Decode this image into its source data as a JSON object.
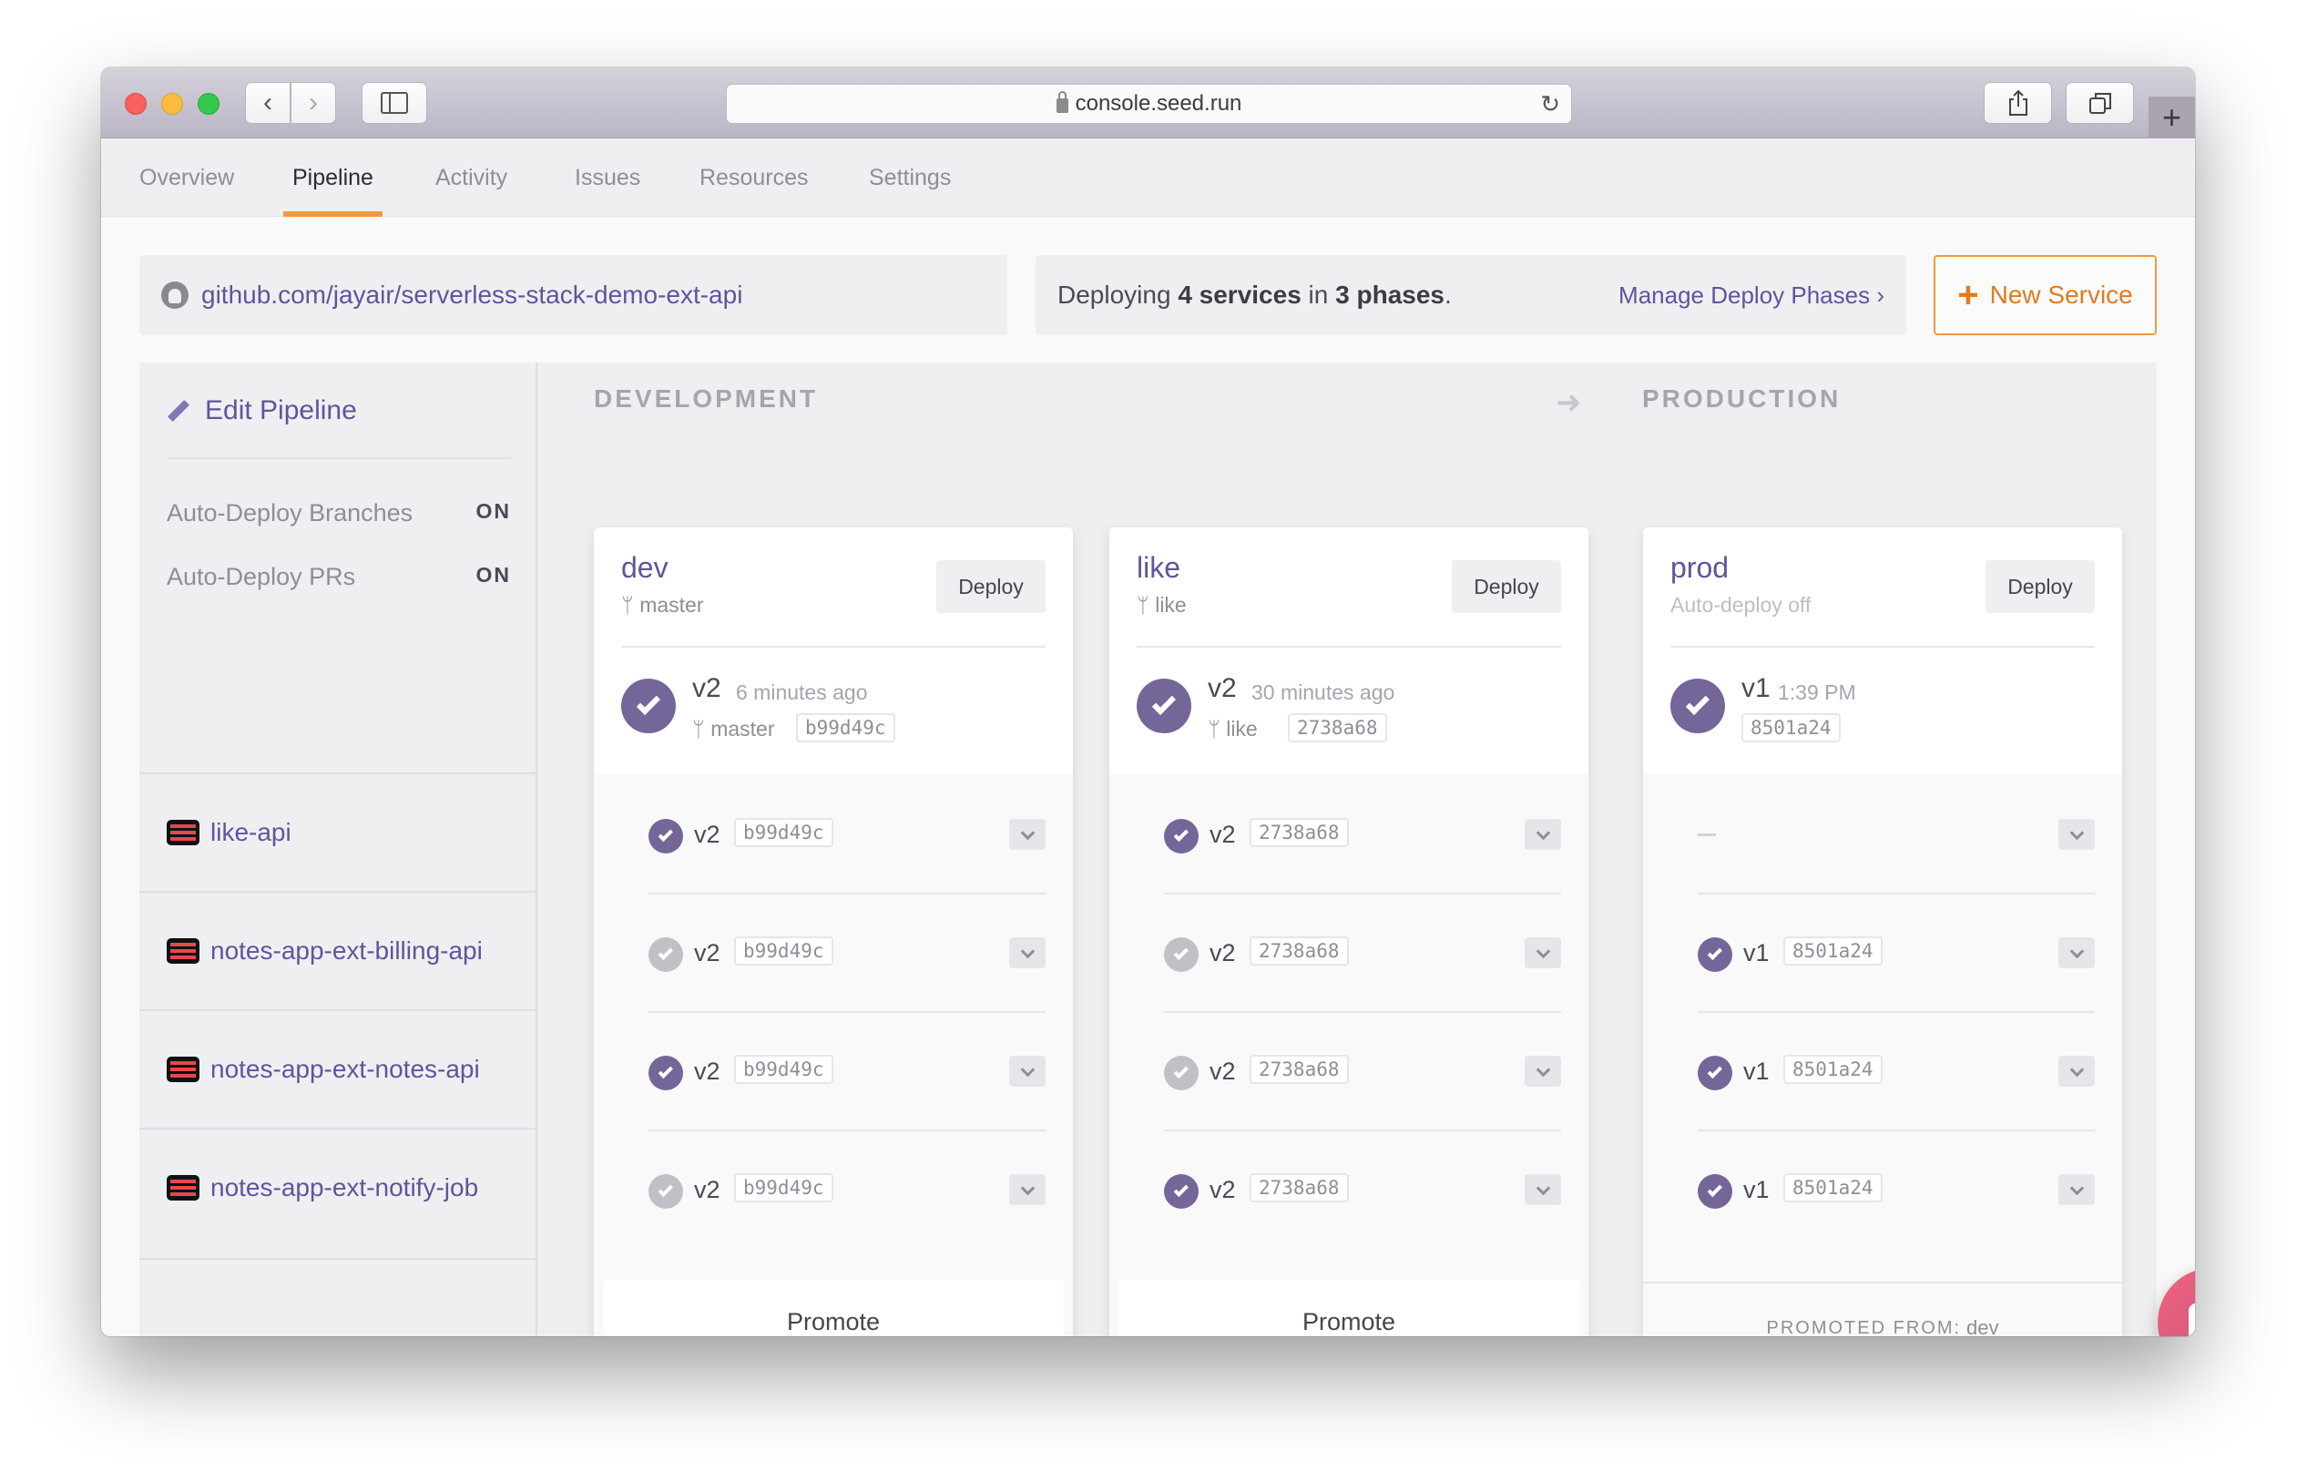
{
  "browser": {
    "url": "console.seed.run"
  },
  "tabs": [
    {
      "label": "Overview",
      "active": false
    },
    {
      "label": "Pipeline",
      "active": true
    },
    {
      "label": "Activity",
      "active": false
    },
    {
      "label": "Issues",
      "active": false
    },
    {
      "label": "Resources",
      "active": false
    },
    {
      "label": "Settings",
      "active": false
    }
  ],
  "repo": {
    "url": "github.com/jayair/serverless-stack-demo-ext-api",
    "icon": "github-icon"
  },
  "deploy_summary": {
    "prefix": "Deploying ",
    "services_count": "4 services",
    "middle": " in ",
    "phases_count": "3 phases",
    "suffix": ".",
    "manage_link": "Manage Deploy Phases ›"
  },
  "new_service_button": {
    "icon": "+",
    "label": "New Service"
  },
  "sidebar": {
    "edit_label": "Edit Pipeline",
    "settings": [
      {
        "label": "Auto-Deploy Branches",
        "value": "ON"
      },
      {
        "label": "Auto-Deploy PRs",
        "value": "ON"
      }
    ],
    "services": [
      {
        "name": "like-api"
      },
      {
        "name": "notes-app-ext-billing-api"
      },
      {
        "name": "notes-app-ext-notes-api"
      },
      {
        "name": "notes-app-ext-notify-job"
      }
    ]
  },
  "stage_groups": {
    "development": "DEVELOPMENT",
    "production": "PRODUCTION"
  },
  "colors": {
    "accent_purple": "#61549c",
    "check_purple": "#756699",
    "check_grey": "#c1c0c6",
    "orange": "#f29a3e"
  },
  "stages": [
    {
      "name": "dev",
      "sub": "master",
      "deploy_label": "Deploy",
      "build": {
        "version": "v2",
        "time": "6 minutes ago",
        "branch": "master",
        "commit": "b99d49c"
      },
      "services": [
        {
          "status": "active",
          "version": "v2",
          "commit": "b99d49c"
        },
        {
          "status": "inactive",
          "version": "v2",
          "commit": "b99d49c"
        },
        {
          "status": "active",
          "version": "v2",
          "commit": "b99d49c"
        },
        {
          "status": "inactive",
          "version": "v2",
          "commit": "b99d49c"
        }
      ],
      "footer": "Promote"
    },
    {
      "name": "like",
      "sub": "like",
      "deploy_label": "Deploy",
      "build": {
        "version": "v2",
        "time": "30 minutes ago",
        "branch": "like",
        "commit": "2738a68"
      },
      "services": [
        {
          "status": "active",
          "version": "v2",
          "commit": "2738a68"
        },
        {
          "status": "inactive",
          "version": "v2",
          "commit": "2738a68"
        },
        {
          "status": "inactive",
          "version": "v2",
          "commit": "2738a68"
        },
        {
          "status": "active",
          "version": "v2",
          "commit": "2738a68"
        }
      ],
      "footer": "Promote"
    },
    {
      "name": "prod",
      "sub": "Auto-deploy off",
      "deploy_label": "Deploy",
      "build": {
        "version": "v1",
        "time": "1:39 PM",
        "branch": "",
        "commit": "8501a24"
      },
      "services": [
        {
          "status": "none",
          "version": "—",
          "commit": ""
        },
        {
          "status": "active",
          "version": "v1",
          "commit": "8501a24"
        },
        {
          "status": "active",
          "version": "v1",
          "commit": "8501a24"
        },
        {
          "status": "active",
          "version": "v1",
          "commit": "8501a24"
        }
      ],
      "footer_label": "PROMOTED FROM:",
      "footer_source": "dev"
    }
  ],
  "chat_widget": {
    "icon": "chat-bubble-icon"
  }
}
